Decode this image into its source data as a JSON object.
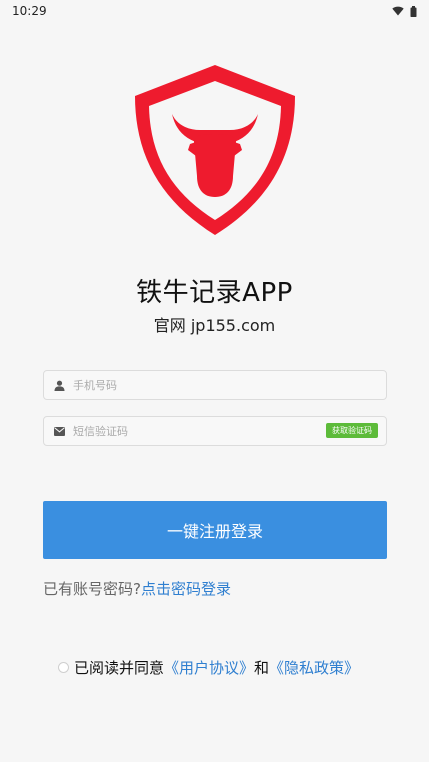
{
  "status_bar": {
    "time": "10:29"
  },
  "app": {
    "title": "铁牛记录APP",
    "subtitle": "官网 jp155.com"
  },
  "form": {
    "phone_placeholder": "手机号码",
    "code_placeholder": "短信验证码",
    "get_code_label": "获取验证码",
    "login_label": "一键注册登录"
  },
  "password_login": {
    "prefix": "已有账号密码?",
    "link": "点击密码登录"
  },
  "agreement": {
    "prefix": "已阅读并同意",
    "user_agreement": "《用户协议》",
    "and": "和",
    "privacy_policy": "《隐私政策》"
  },
  "colors": {
    "brand_red": "#ee1b2e",
    "primary_blue": "#3a8fe0",
    "link_blue": "#2f7fd0",
    "code_green": "#5dbb3a"
  },
  "icons": {
    "logo": "shield-bull-logo",
    "phone_field": "person-icon",
    "code_field": "envelope-icon",
    "wifi": "wifi-icon",
    "battery": "battery-icon"
  }
}
